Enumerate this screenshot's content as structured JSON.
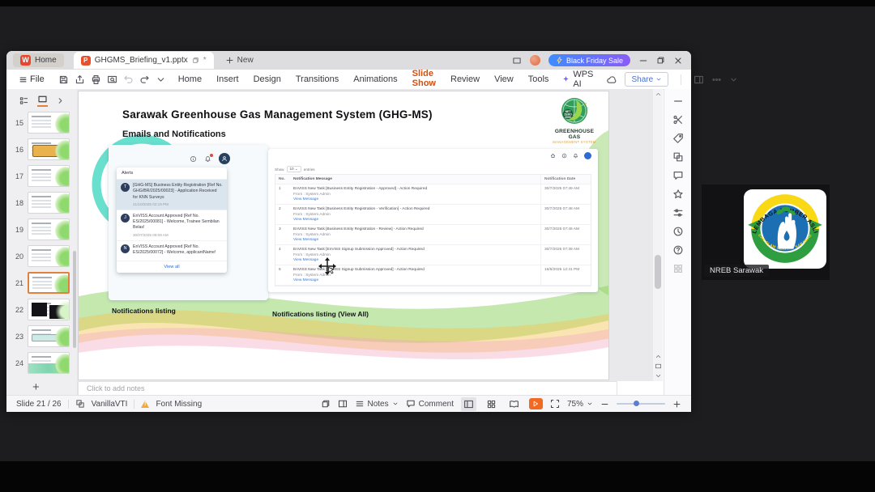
{
  "titlebar": {
    "home_tab": "Home",
    "doc_tab": "GHGMS_Briefing_v1.pptx",
    "doc_modified": "*",
    "new_tab": "New",
    "promo": "Black Friday Sale"
  },
  "menubar": {
    "file": "File",
    "items": [
      {
        "label": "Home",
        "cls": ""
      },
      {
        "label": "Insert",
        "cls": ""
      },
      {
        "label": "Design",
        "cls": ""
      },
      {
        "label": "Transitions",
        "cls": ""
      },
      {
        "label": "Animations",
        "cls": ""
      },
      {
        "label": "Slide Show",
        "cls": "active"
      },
      {
        "label": "Review",
        "cls": ""
      },
      {
        "label": "View",
        "cls": ""
      },
      {
        "label": "Tools",
        "cls": ""
      }
    ],
    "wps_ai": "WPS AI",
    "share": "Share"
  },
  "quick_icons": [
    {
      "name": "save-icon",
      "icon": "#i-save"
    },
    {
      "name": "export-pdf-icon",
      "icon": "#i-export"
    },
    {
      "name": "print-icon",
      "icon": "#i-print"
    },
    {
      "name": "print-preview-icon",
      "icon": "#i-ppreview"
    },
    {
      "name": "undo-icon",
      "icon": "#i-undo"
    },
    {
      "name": "redo-icon",
      "icon": "#i-redo"
    },
    {
      "name": "more-commands-icon",
      "icon": "#i-chevd"
    }
  ],
  "slide_panel": {
    "slides": [
      {
        "num": "15",
        "cls": "v15"
      },
      {
        "num": "16",
        "cls": "v16"
      },
      {
        "num": "17",
        "cls": "v17"
      },
      {
        "num": "18",
        "cls": "v18"
      },
      {
        "num": "19",
        "cls": "v19"
      },
      {
        "num": "20",
        "cls": "v20"
      },
      {
        "num": "21",
        "cls": "v21 current"
      },
      {
        "num": "22",
        "cls": "v22"
      },
      {
        "num": "23",
        "cls": "v23"
      },
      {
        "num": "24",
        "cls": "v24"
      }
    ]
  },
  "slide": {
    "title": "Sarawak Greenhouse Gas Management System (GHG-MS)",
    "subtitle": "Emails and Notifications",
    "logo": {
      "line1": "GREENHOUSE GAS",
      "line2": "MANAGEMENT SYSTEM",
      "badge_l1": "NET",
      "badge_l2": "ZERO",
      "badge_l3": "2050"
    },
    "alerts": {
      "header": "Alerts",
      "items": [
        {
          "avatar": "T",
          "text": "[GHG-MS] Business Entity Registration [Ref No. GHG/BR/2025/00023] - Application Received for KNN Surveys",
          "time": "21/10/2025 02:19 PM",
          "cls": "selected"
        },
        {
          "avatar": "J",
          "text": "EnVISS Account Approved [Ref No. ES/2025/00081] - Welcome, Trainee Sembilan Belas!",
          "time": "30/07/2025 09:09 AM",
          "cls": "plain"
        },
        {
          "avatar": "N",
          "text": "EnVISS Account Approved [Ref No. ES/2025/00072] - Welcome, applicantName!",
          "time": "",
          "cls": "plain"
        }
      ],
      "view_all": "View all"
    },
    "listing": {
      "show": "Show",
      "show_value": "10",
      "entries": "entries",
      "col_no": "No.",
      "col_msg": "Notification Message",
      "col_date": "Notification Date",
      "rows": [
        {
          "no": "1",
          "message": "EnVISS New Task [Business Entity Registration - Approved] - Action Required",
          "from": "From : System Admin",
          "link": "View Message",
          "date": "30/7/2025 07:49 AM"
        },
        {
          "no": "2",
          "message": "EnVISS New Task [Business Entity Registration - Verification] - Action Required",
          "from": "From : System Admin",
          "link": "View Message",
          "date": "30/7/2025 07:48 AM"
        },
        {
          "no": "3",
          "message": "EnVISS New Task [Business Entity Registration - Review] - Action Required",
          "from": "From : System Admin",
          "link": "View Message",
          "date": "30/7/2025 07:46 AM"
        },
        {
          "no": "4",
          "message": "EnVISS New Task [EnVISS Signup Submission Approved] - Action Required",
          "from": "From : System Admin",
          "link": "View Message",
          "date": "30/7/2025 07:39 AM"
        },
        {
          "no": "5",
          "message": "EnVISS New Task [EnVISS Signup Submission Approved] - Action Required",
          "from": "From : System Admin",
          "link": "View Message",
          "date": "16/6/2025 12:41 PM"
        }
      ]
    },
    "caption_left": "Notifications listing",
    "caption_right": "Notifications listing (View All)"
  },
  "sidebar_icons": [
    {
      "name": "collapse-panel-icon",
      "icon": "#i-winmin"
    },
    {
      "name": "design-tools-icon",
      "icon": "#i-scissors"
    },
    {
      "name": "find-replace-icon",
      "icon": "#i-tag"
    },
    {
      "name": "shapes-icon",
      "icon": "#i-shapes2"
    },
    {
      "name": "comment-panel-icon",
      "icon": "#i-comment"
    },
    {
      "name": "favorites-icon",
      "icon": "#i-star"
    },
    {
      "name": "settings-icon",
      "icon": "#i-sliders"
    },
    {
      "name": "history-icon",
      "icon": "#i-clock"
    },
    {
      "name": "help-icon",
      "icon": "#i-help"
    },
    {
      "name": "apps-icon",
      "icon": "#i-grid4"
    }
  ],
  "notes": {
    "placeholder": "Click to add notes"
  },
  "statusbar": {
    "slide_info": "Slide 21 / 26",
    "theme": "VanillaVTI",
    "font_missing": "Font Missing",
    "notes_label": "Notes",
    "comment_label": "Comment",
    "zoom": "75%"
  },
  "participant": {
    "name": "NREB Sarawak",
    "logo_top": "LEMBAGA SUMBER ASLI",
    "logo_bottom": "DAN ALAM SEKITAR SARAWAK"
  },
  "colors": {
    "accent_orange": "#d3500f",
    "promo_from": "#3f8cff",
    "promo_to": "#8a5cf6",
    "play_orange": "#f26a21",
    "link_blue": "#3b7bd4",
    "teal": "#4fd9c6"
  }
}
